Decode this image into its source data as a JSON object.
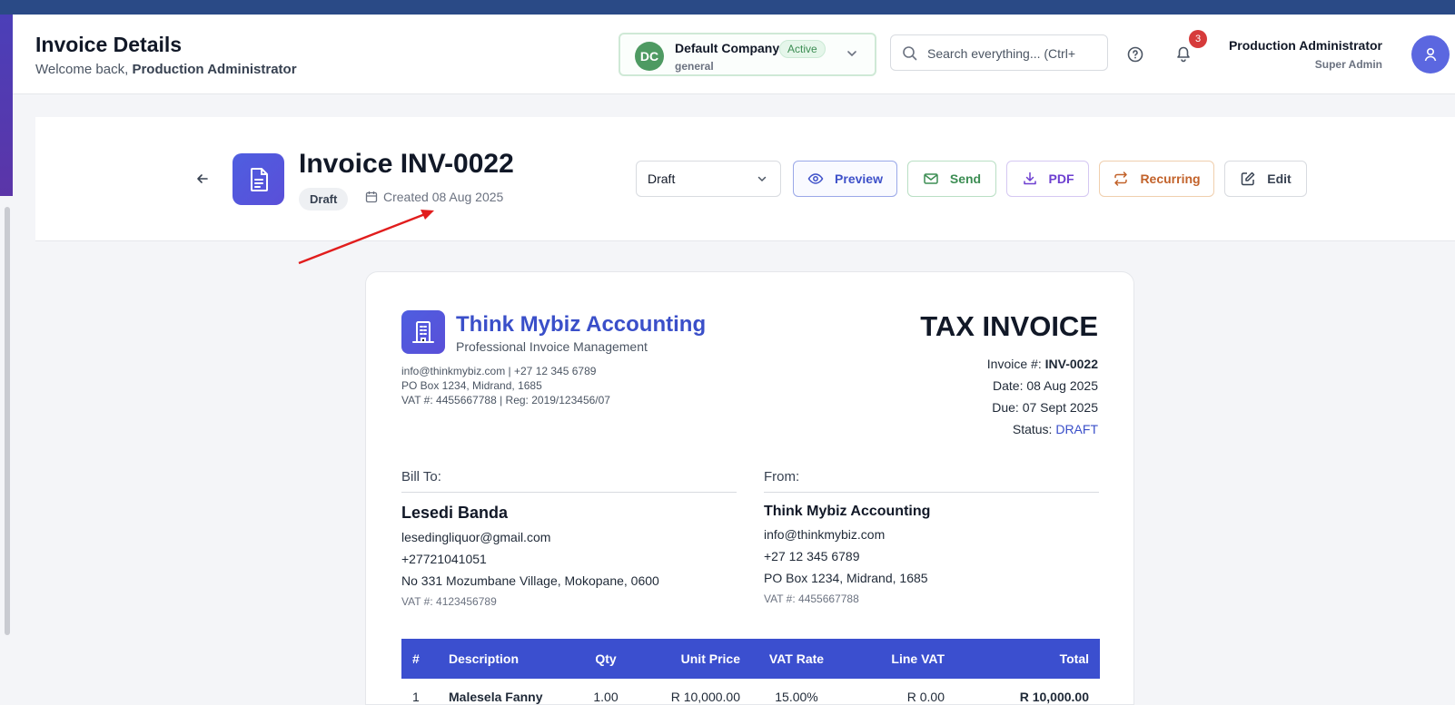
{
  "header": {
    "title": "Invoice Details",
    "welcome_prefix": "Welcome back, ",
    "welcome_user": "Production Administrator",
    "company": {
      "initials": "DC",
      "name": "Default Company",
      "status": "Active",
      "subtitle": "general"
    },
    "search_placeholder": "Search everything... (Ctrl+",
    "notification_count": "3",
    "user_name": "Production Administrator",
    "user_role": "Super Admin"
  },
  "toolbar": {
    "invoice_title": "Invoice INV-0022",
    "status_pill": "Draft",
    "created": "Created 08 Aug 2025",
    "status_select": "Draft",
    "buttons": {
      "preview": "Preview",
      "send": "Send",
      "pdf": "PDF",
      "recurring": "Recurring",
      "edit": "Edit"
    }
  },
  "invoice": {
    "brand_name": "Think Mybiz Accounting",
    "brand_tagline": "Professional Invoice Management",
    "brand_contact_1": "info@thinkmybiz.com | +27 12 345 6789",
    "brand_contact_2": "PO Box 1234, Midrand, 1685",
    "brand_contact_3": "VAT #: 4455667788 | Reg: 2019/123456/07",
    "doc_title": "TAX INVOICE",
    "number_label": "Invoice #: ",
    "number": "INV-0022",
    "date": "Date: 08 Aug 2025",
    "due": "Due: 07 Sept 2025",
    "status_label": "Status: ",
    "status": "DRAFT",
    "bill_to": {
      "label": "Bill To:",
      "name": "Lesedi Banda",
      "email": "lesedingliquor@gmail.com",
      "phone": "+27721041051",
      "address": "No 331 Mozumbane Village, Mokopane, 0600",
      "vat": "VAT #: 4123456789"
    },
    "from": {
      "label": "From:",
      "name": "Think Mybiz Accounting",
      "email": "info@thinkmybiz.com",
      "phone": "+27 12 345 6789",
      "address": "PO Box 1234, Midrand, 1685",
      "vat": "VAT #: 4455667788"
    },
    "table": {
      "headers": [
        "#",
        "Description",
        "Qty",
        "Unit Price",
        "VAT Rate",
        "Line VAT",
        "Total"
      ],
      "rows": [
        [
          "1",
          "Malesela Fanny",
          "1.00",
          "R 10,000.00",
          "15.00%",
          "R 0.00",
          "R 10,000.00"
        ]
      ]
    }
  },
  "colors": {
    "primary": "#3b4fcf",
    "success": "#3c8d53",
    "recurring": "#c2622a",
    "pdf": "#6d3fd0",
    "annotation_arrow": "#e11d1d"
  }
}
